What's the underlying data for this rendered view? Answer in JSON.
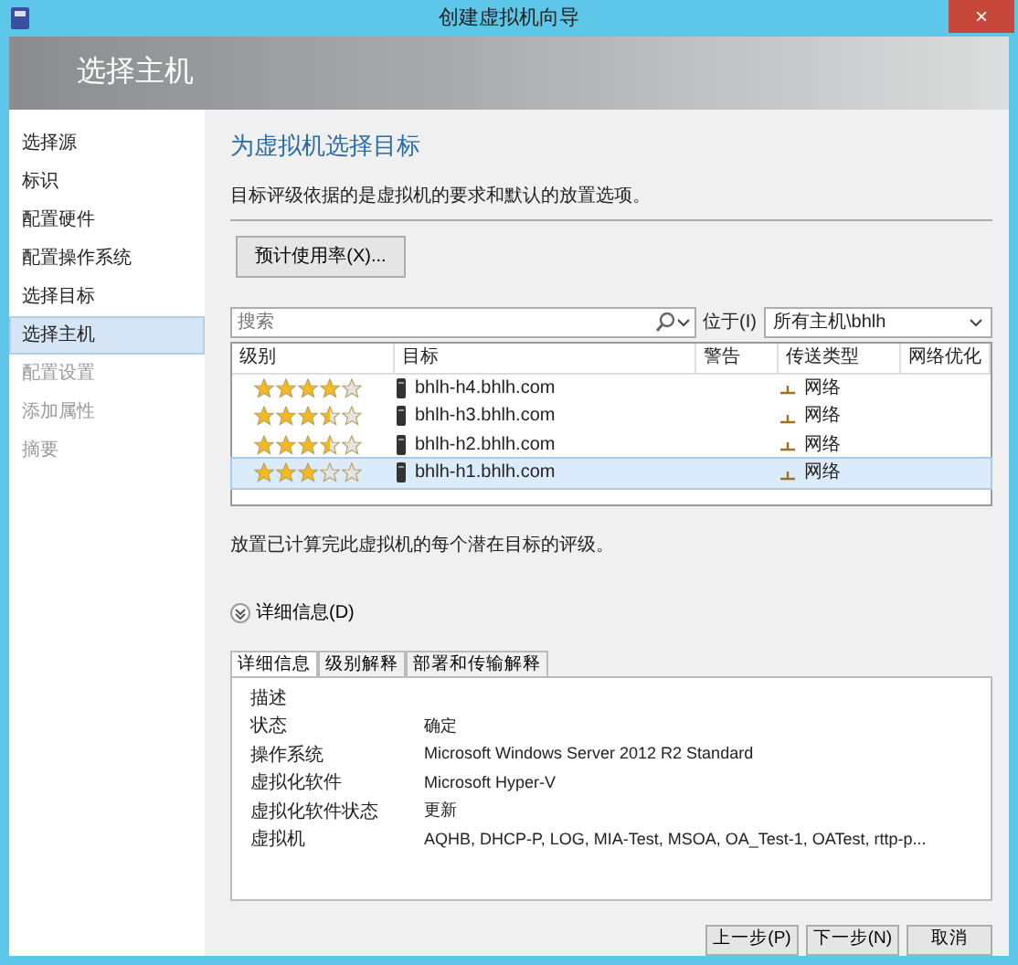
{
  "window": {
    "title": "创建虚拟机向导",
    "close": "×"
  },
  "header": {
    "title": "选择主机"
  },
  "sidebar": {
    "items": [
      {
        "label": "选择源",
        "selected": false,
        "disabled": false
      },
      {
        "label": "标识",
        "selected": false,
        "disabled": false
      },
      {
        "label": "配置硬件",
        "selected": false,
        "disabled": false
      },
      {
        "label": "配置操作系统",
        "selected": false,
        "disabled": false
      },
      {
        "label": "选择目标",
        "selected": false,
        "disabled": false
      },
      {
        "label": "选择主机",
        "selected": true,
        "disabled": false
      },
      {
        "label": "配置设置",
        "selected": false,
        "disabled": true
      },
      {
        "label": "添加属性",
        "selected": false,
        "disabled": true
      },
      {
        "label": "摘要",
        "selected": false,
        "disabled": true
      }
    ]
  },
  "content": {
    "heading": "为虚拟机选择目标",
    "intro": "目标评级依据的是虚拟机的要求和默认的放置选项。",
    "estimate_button": "预计使用率(X)...",
    "search": {
      "placeholder": "搜索"
    },
    "location_label": "位于(I)",
    "location_value": "所有主机\\bhlh",
    "table": {
      "columns": [
        "级别",
        "目标",
        "警告",
        "传送类型",
        "网络优化"
      ],
      "rows": [
        {
          "stars": 4,
          "target": "bhlh-h4.bhlh.com",
          "transfer": "网络",
          "selected": false
        },
        {
          "stars": 3.5,
          "target": "bhlh-h3.bhlh.com",
          "transfer": "网络",
          "selected": false
        },
        {
          "stars": 3.5,
          "target": "bhlh-h2.bhlh.com",
          "transfer": "网络",
          "selected": false
        },
        {
          "stars": 3,
          "target": "bhlh-h1.bhlh.com",
          "transfer": "网络",
          "selected": true
        }
      ]
    },
    "note": "放置已计算完此虚拟机的每个潜在目标的评级。",
    "details_toggle": {
      "label": "详细信息(D)",
      "expanded": true
    },
    "tabs": [
      {
        "label": "详细信息",
        "selected": true
      },
      {
        "label": "级别解释",
        "selected": false
      },
      {
        "label": "部署和传输解释",
        "selected": false
      }
    ],
    "details": [
      {
        "key": "描述"
      },
      {
        "key": "状态",
        "value": "确定"
      },
      {
        "key": "操作系统",
        "value": "Microsoft Windows Server 2012 R2 Standard"
      },
      {
        "key": "虚拟化软件",
        "value": "Microsoft Hyper-V"
      },
      {
        "key": "虚拟化软件状态",
        "value": "更新"
      },
      {
        "key": "虚拟机",
        "value": "AQHB, DHCP-P, LOG, MIA-Test, MSOA, OA_Test-1, OATest, rttp-p..."
      }
    ]
  },
  "buttons": [
    "上一步(P)",
    "下一步(N)",
    "取消"
  ]
}
